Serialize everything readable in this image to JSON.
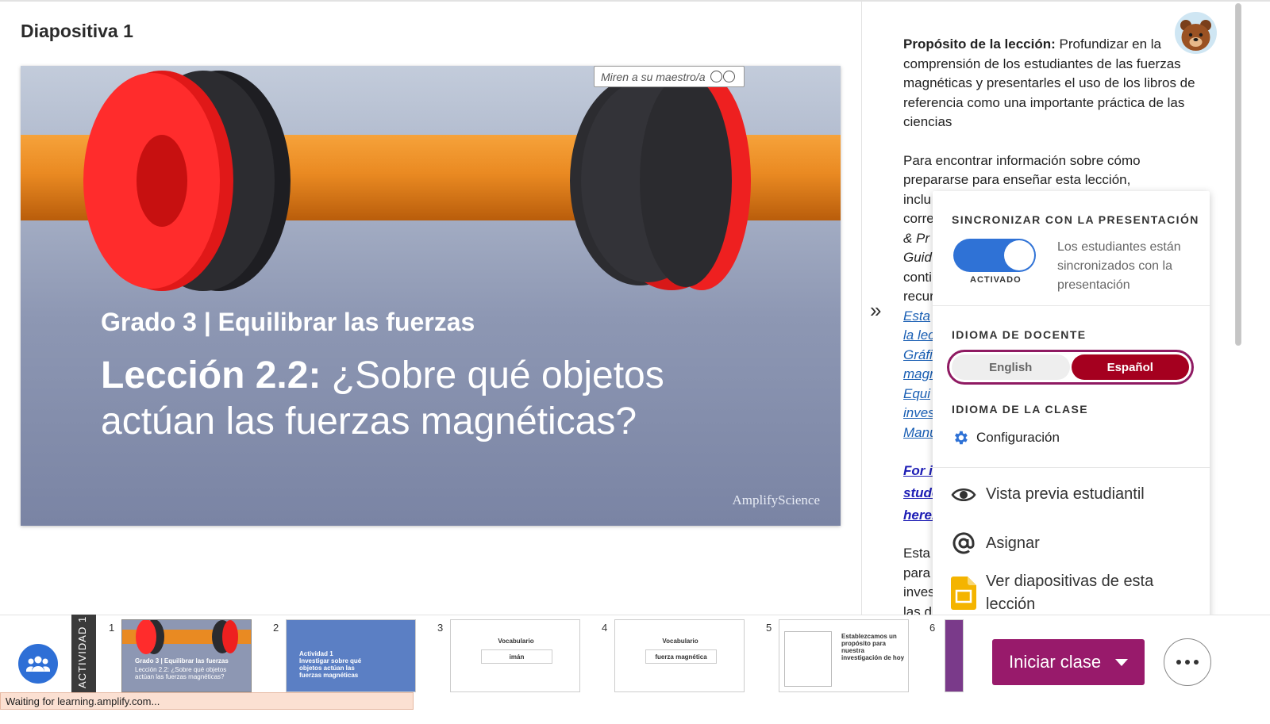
{
  "slide_title": "Diapositiva 1",
  "slide": {
    "grade_line": "Grado 3 | Equilibrar las fuerzas",
    "lesson_prefix": "Lección 2.2:",
    "lesson_question": "¿Sobre qué objetos actúan las fuerzas magnéticas?",
    "brand": "AmplifyScience",
    "watch_label": "Miren a su maestro/a"
  },
  "notes": {
    "purpose_label": "Propósito de la lección:",
    "purpose_text": " Profundizar en la comprensión de los estudiantes de las fuerzas magnéticas y presentarles el uso de los libros de referencia como una importante práctica de las ciencias",
    "p2": "Para encontrar información sobre cómo prepararse para enseñar esta lección,",
    "p2_lines": [
      "inclu",
      "corre",
      "& Pr",
      "Guid",
      "conti",
      "recur"
    ],
    "p2_links": [
      "Esta",
      "la lec",
      "Gráfi",
      "magn",
      "Equi",
      "inves",
      "Manu"
    ],
    "bold_links": [
      "For i",
      "stude",
      "here."
    ],
    "p4_lines": [
      "Esta",
      "para",
      "inves",
      "las d"
    ]
  },
  "popup": {
    "sync_heading": "SINCRONIZAR CON LA PRESENTACIÓN",
    "toggle_label": "ACTIVADO",
    "sync_desc": "Los estudiantes están sincronizados con la presentación",
    "teacher_lang_heading": "IDIOMA DE DOCENTE",
    "lang_english": "English",
    "lang_spanish": "Español",
    "class_lang_heading": "IDIOMA DE LA CLASE",
    "config_label": "Configuración",
    "student_preview": "Vista previa estudiantil",
    "assign": "Asignar",
    "view_slides": "Ver diapositivas de esta lección"
  },
  "filmstrip": {
    "activity_tab": "ACTIVIDAD 1",
    "thumbs": [
      {
        "num": "1",
        "title": "Grado 3 | Equilibrar las fuerzas",
        "sub": "Lección 2.2: ¿Sobre qué objetos actúan las fuerzas magnéticas?"
      },
      {
        "num": "2",
        "title": "Actividad 1",
        "sub": "Investigar sobre qué objetos actúan las fuerzas magnéticas"
      },
      {
        "num": "3",
        "title": "Vocabulario",
        "sub": "imán"
      },
      {
        "num": "4",
        "title": "Vocabulario",
        "sub": "fuerza magnética"
      },
      {
        "num": "5",
        "title": "Establezcamos un propósito para nuestra investigación de hoy",
        "sub": ""
      },
      {
        "num": "6",
        "title": "",
        "sub": ""
      }
    ]
  },
  "start_button": "Iniciar clase",
  "status_bar": "Waiting for learning.amplify.com...",
  "colors": {
    "toggle_blue": "#2f72d6",
    "spanish_red": "#a5001f",
    "start_purple": "#981a6b",
    "lang_border": "#8f1a62"
  }
}
